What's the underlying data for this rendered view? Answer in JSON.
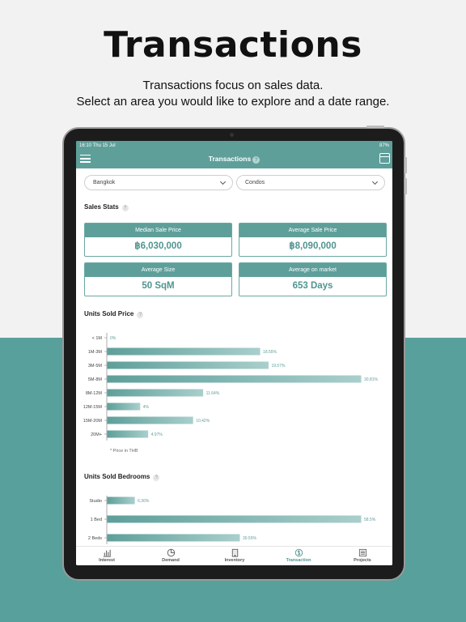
{
  "hero": {
    "title": "Transactions",
    "subtitle_line1": "Transactions focus on sales data.",
    "subtitle_line2": "Select an area you would like to explore and a date range."
  },
  "status_bar": {
    "time": "16:10  Thu 15 Jul",
    "battery": "87%"
  },
  "nav": {
    "title": "Transactions",
    "help": "?"
  },
  "filters": {
    "area": "Bangkok",
    "property_type": "Condos"
  },
  "sales_stats": {
    "heading": "Sales Stats",
    "help": "?",
    "cards": [
      {
        "label": "Median Sale Price",
        "value": "฿6,030,000"
      },
      {
        "label": "Average Sale Price",
        "value": "฿8,090,000"
      },
      {
        "label": "Average Size",
        "value": "50 SqM"
      },
      {
        "label": "Average on market",
        "value": "653 Days"
      }
    ]
  },
  "units_price": {
    "heading": "Units Sold Price",
    "help": "?",
    "footnote": "* Price in THB"
  },
  "units_bedrooms": {
    "heading": "Units Sold Bedrooms",
    "help": "?"
  },
  "chart_data": [
    {
      "type": "bar",
      "orientation": "horizontal",
      "categories": [
        "< 1M",
        "1M-3M",
        "3M-5M",
        "5M-8M",
        "8M-12M",
        "12M-15M",
        "15M-20M",
        "20M+"
      ],
      "values": [
        0,
        18.55,
        19.57,
        30.81,
        11.64,
        4,
        10.42,
        4.97
      ],
      "value_labels": [
        "0%",
        "18.55%",
        "19.57%",
        "30.81%",
        "11.64%",
        "4%",
        "10.42%",
        "4.97%"
      ]
    },
    {
      "type": "bar",
      "orientation": "horizontal",
      "categories": [
        "Studio",
        "1 Bed",
        "2 Beds"
      ],
      "values": [
        6.36,
        58.5,
        30.55
      ],
      "value_labels": [
        "6.36%",
        "58.5%",
        "30.55%"
      ]
    }
  ],
  "colors": {
    "accent": "#5e9f9a",
    "bar_start": "#5e9f9a",
    "bar_end": "#a9cfcc",
    "page_bottom": "#58a09c"
  },
  "tabs": [
    {
      "label": "Interest",
      "icon": "bar-chart-icon"
    },
    {
      "label": "Demand",
      "icon": "pie-chart-icon"
    },
    {
      "label": "Inventory",
      "icon": "building-icon"
    },
    {
      "label": "Transaction",
      "icon": "currency-icon"
    },
    {
      "label": "Projects",
      "icon": "list-icon"
    }
  ]
}
